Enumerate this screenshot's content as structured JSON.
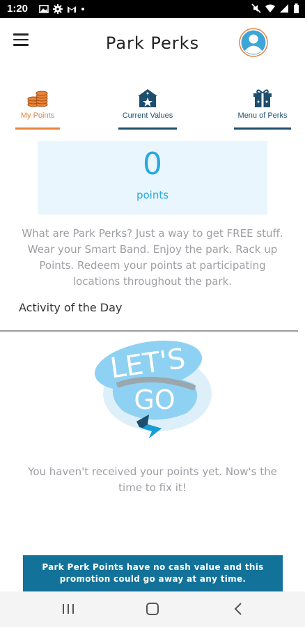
{
  "status_bar": {
    "time": "1:20",
    "left_icons": [
      "image-icon",
      "gear-icon",
      "gmail-icon",
      "dot-icon"
    ],
    "right_icons": [
      "mute-icon",
      "wifi-icon",
      "signal-icon",
      "battery-icon"
    ]
  },
  "header": {
    "title": "Park Perks",
    "menu_icon": "hamburger-menu-icon",
    "avatar_icon": "user-avatar-icon"
  },
  "tabs": [
    {
      "label": "My Points",
      "icon": "coins-stack-icon",
      "active": true
    },
    {
      "label": "Current Values",
      "icon": "star-store-icon",
      "active": false
    },
    {
      "label": "Menu of Perks",
      "icon": "gift-box-icon",
      "active": false
    }
  ],
  "points": {
    "value": "0",
    "label": "points"
  },
  "description": "What are Park Perks? Just a way to get FREE stuff. Wear your Smart Band. Enjoy the park. Rack up Points. Redeem your points at participating locations throughout the park.",
  "activity": {
    "title": "Activity of the Day",
    "graphic_text_top": "LET'S",
    "graphic_text_bottom": "GO",
    "empty_message": "You haven't received your points yet. Now's the time to fix it!"
  },
  "disclaimer": "Park Perk Points have no cash value and this promotion could go away at any time.",
  "colors": {
    "accent_orange": "#e8833a",
    "navy": "#1d4e6e",
    "light_blue": "#29a9df",
    "banner_blue": "#13729a"
  },
  "nav_bar": [
    "recent-apps-icon",
    "home-icon",
    "back-icon"
  ]
}
